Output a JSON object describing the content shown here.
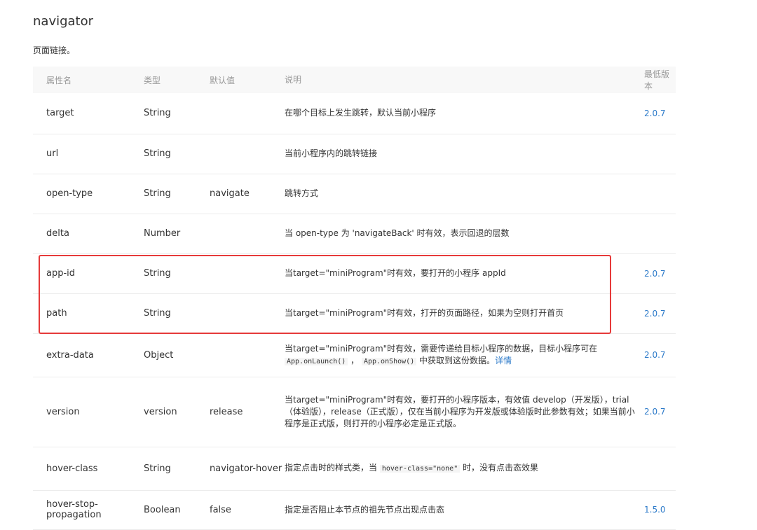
{
  "title": "navigator",
  "description": "页面链接。",
  "headers": [
    "属性名",
    "类型",
    "默认值",
    "说明",
    "最低版本"
  ],
  "rows": [
    {
      "name": "target",
      "type": "String",
      "default": "",
      "desc": "在哪个目标上发生跳转，默认当前小程序",
      "version": "2.0.7"
    },
    {
      "name": "url",
      "type": "String",
      "default": "",
      "desc": "当前小程序内的跳转链接",
      "version": ""
    },
    {
      "name": "open-type",
      "type": "String",
      "default": "navigate",
      "desc": "跳转方式",
      "version": ""
    },
    {
      "name": "delta",
      "type": "Number",
      "default": "",
      "desc": "当 open-type 为 'navigateBack' 时有效，表示回退的层数",
      "version": ""
    },
    {
      "name": "app-id",
      "type": "String",
      "default": "",
      "desc": "当target=\"miniProgram\"时有效，要打开的小程序 appId",
      "version": "2.0.7"
    },
    {
      "name": "path",
      "type": "String",
      "default": "",
      "desc": "当target=\"miniProgram\"时有效，打开的页面路径，如果为空则打开首页",
      "version": "2.0.7"
    },
    {
      "name": "extra-data",
      "type": "Object",
      "default": "",
      "desc_prefix": "当target=\"miniProgram\"时有效，需要传递给目标小程序的数据，目标小程序可在",
      "code1": "App.onLaunch()",
      "desc_sep": "，",
      "code2": "App.onShow()",
      "desc_suffix": "中获取到这份数据。",
      "link": "详情",
      "version": "2.0.7"
    },
    {
      "name": "version",
      "type": "version",
      "default": "release",
      "desc": "当target=\"miniProgram\"时有效，要打开的小程序版本，有效值 develop（开发版），trial（体验版），release（正式版），仅在当前小程序为开发版或体验版时此参数有效；如果当前小程序是正式版，则打开的小程序必定是正式版。",
      "version": "2.0.7"
    },
    {
      "name": "hover-class",
      "type": "String",
      "default": "navigator-hover",
      "desc_prefix": "指定点击时的样式类，当",
      "code1": "hover-class=\"none\"",
      "desc_suffix": "时，没有点击态效果",
      "version": ""
    },
    {
      "name": "hover-stop-propagation",
      "type": "Boolean",
      "default": "false",
      "desc": "指定是否阻止本节点的祖先节点出现点击态",
      "version": "1.5.0"
    }
  ],
  "colors": {
    "highlight": "#e63a3a",
    "link": "#2c7ac9",
    "header_bg": "#f8f8f8"
  }
}
